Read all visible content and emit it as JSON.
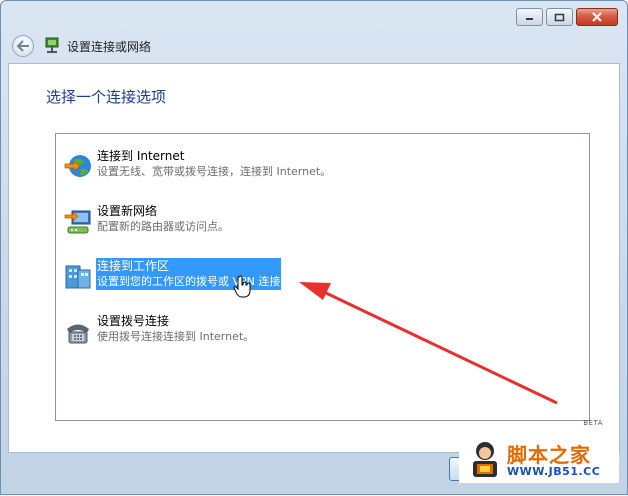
{
  "window": {
    "title": "设置连接或网络"
  },
  "page": {
    "heading": "选择一个连接选项"
  },
  "options": [
    {
      "title": "连接到 Internet",
      "desc": "设置无线、宽带或拨号连接，连接到 Internet。",
      "icon": "globe-internet-icon",
      "selected": false
    },
    {
      "title": "设置新网络",
      "desc": "配置新的路由器或访问点。",
      "icon": "router-network-icon",
      "selected": false
    },
    {
      "title": "连接到工作区",
      "desc": "设置到您的工作区的拨号或 VPN 连接",
      "icon": "workplace-building-icon",
      "selected": true
    },
    {
      "title": "设置拨号连接",
      "desc": "使用拨号连接连接到 Internet。",
      "icon": "dialup-phone-icon",
      "selected": false
    }
  ],
  "beta_label": "BETA",
  "watermark": {
    "title": "脚本之家",
    "url": "WWW.JB51.CC"
  },
  "colors": {
    "selection": "#3399ff",
    "heading": "#1e3f8a",
    "arrow": "#e8312f"
  }
}
